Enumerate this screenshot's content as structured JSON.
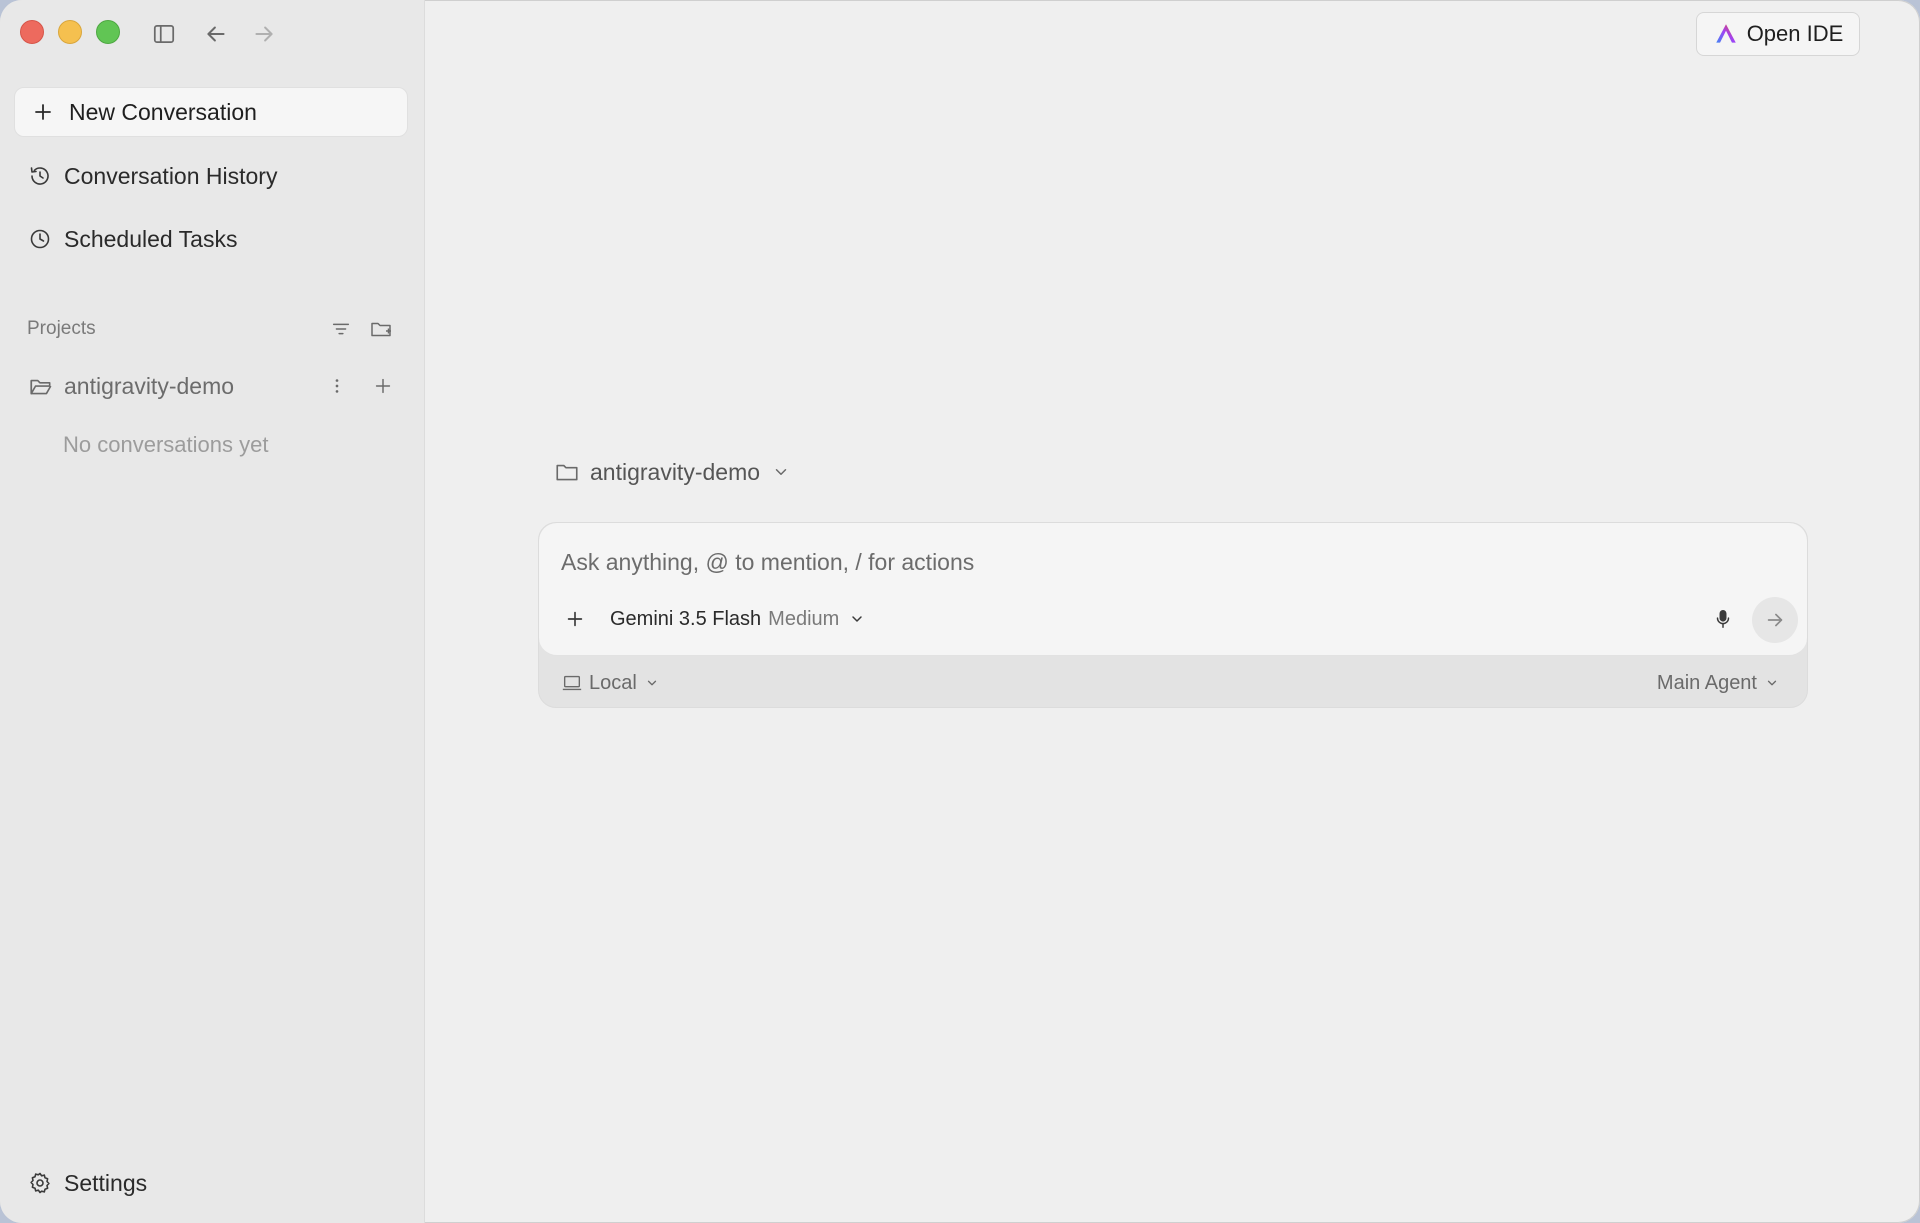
{
  "sidebar": {
    "new_conversation": "New Conversation",
    "conversation_history": "Conversation History",
    "scheduled_tasks": "Scheduled Tasks",
    "projects_label": "Projects",
    "projects": [
      {
        "name": "antigravity-demo",
        "empty_text": "No conversations yet"
      }
    ],
    "settings": "Settings"
  },
  "header": {
    "open_ide": "Open IDE"
  },
  "main": {
    "project_selector": "antigravity-demo",
    "composer": {
      "placeholder": "Ask anything, @ to mention, / for actions",
      "model_name": "Gemini 3.5 Flash",
      "model_effort": "Medium"
    },
    "footer": {
      "environment": "Local",
      "agent": "Main Agent"
    }
  },
  "icons": {
    "traffic_lights": [
      "close",
      "minimize",
      "zoom"
    ],
    "sidebar_toggle": "sidebar-toggle-icon",
    "back": "arrow-left-icon",
    "forward": "arrow-right-icon"
  },
  "colors": {
    "close": "#ed6a5e",
    "minimize": "#f5c04f",
    "zoom": "#61c554",
    "sidebar_bg": "#e8e8e8",
    "main_bg": "#efefef"
  }
}
